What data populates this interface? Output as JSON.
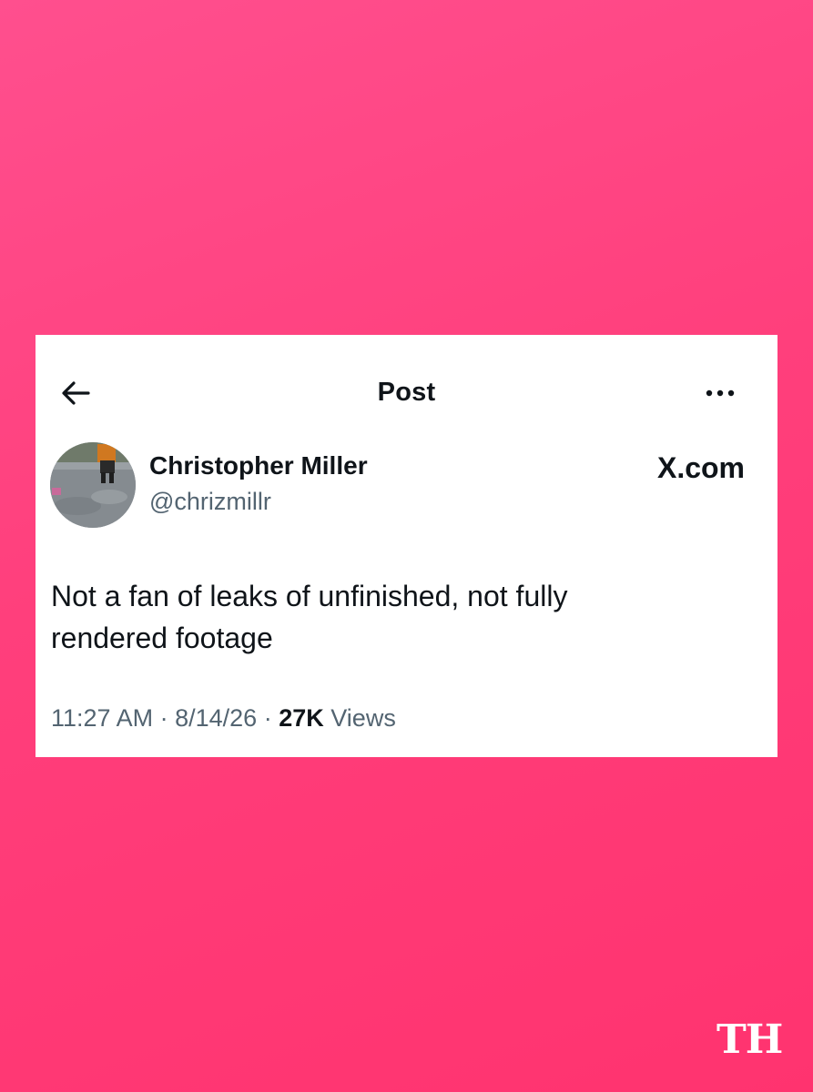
{
  "header": {
    "title": "Post",
    "back_icon": "arrow-left-icon",
    "more_icon": "more-horizontal-icon"
  },
  "author": {
    "display_name": "Christopher Miller",
    "handle": "@chrizmillr"
  },
  "site_label": "X.com",
  "post": {
    "text_line1": "Not a fan of leaks of unfinished, not fully",
    "text_line2": "rendered footage"
  },
  "meta": {
    "time": "11:27 AM",
    "separator": "·",
    "date": "8/14/26",
    "views_count": "27K",
    "views_label": "Views"
  },
  "watermark": "TH",
  "colors": {
    "background": "#ff4383",
    "card": "#ffffff",
    "text_primary": "#0f1419",
    "text_secondary": "#536471"
  }
}
